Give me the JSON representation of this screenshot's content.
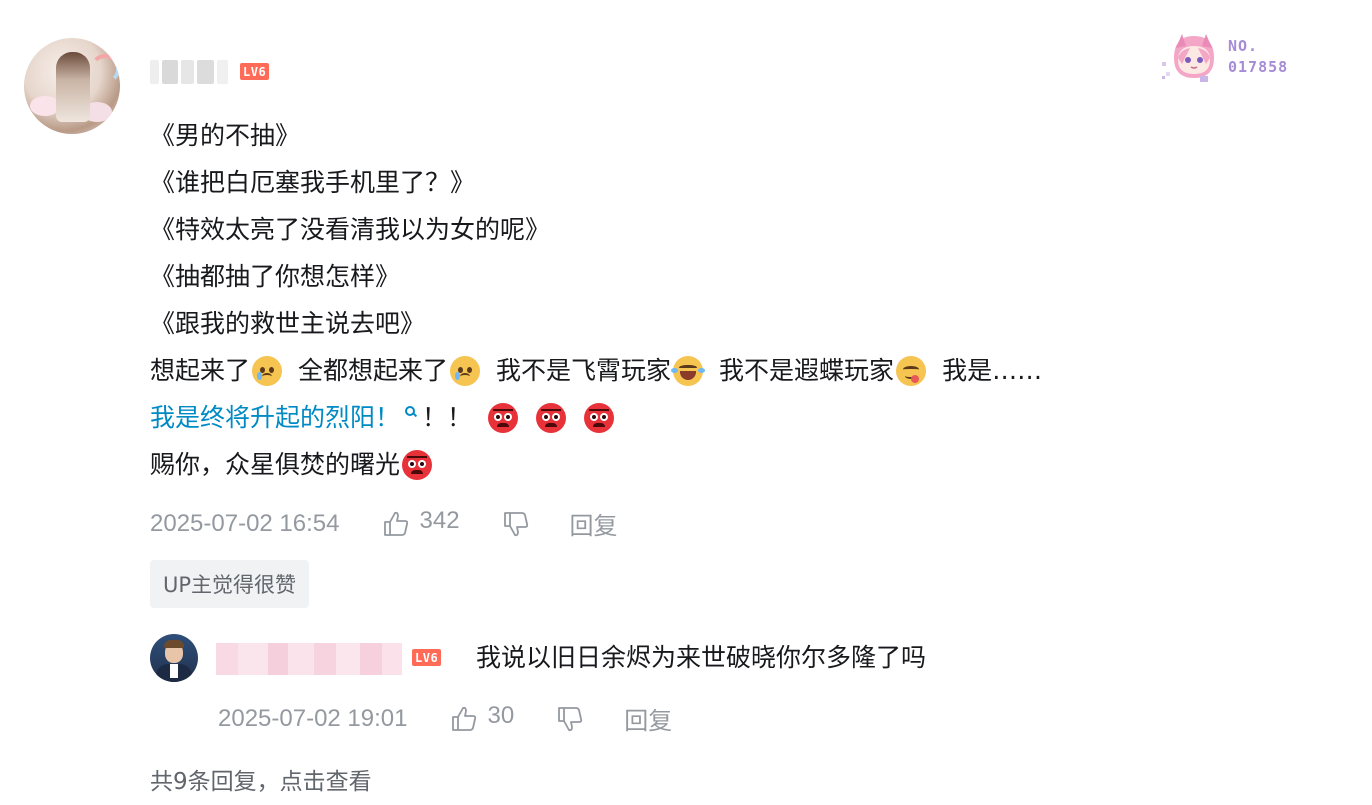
{
  "comment": {
    "level_badge": "LV6",
    "fan_badge": {
      "label_no": "NO.",
      "number": "017858"
    },
    "lines": [
      "《男的不抽》",
      "《谁把白厄塞我手机里了？》",
      "《特效太亮了没看清我以为女的呢》",
      "《抽都抽了你想怎样》",
      "《跟我的救世主说去吧》"
    ],
    "line6": {
      "p1": "想起来了",
      "p2": "全都想起来了",
      "p3": "我不是飞霄玩家",
      "p4": "我不是遐蝶玩家",
      "p5": "我是……"
    },
    "line7": {
      "link": "我是终将升起的烈阳！",
      "tail": "！！"
    },
    "line8": "赐你，众星俱焚的曙光",
    "time": "2025-07-02 16:54",
    "likes": "342",
    "reply_label": "回复",
    "up_liked_tag": "UP主觉得很赞"
  },
  "reply": {
    "level_badge": "LV6",
    "text": "我说以旧日余烬为来世破晓你尔多隆了吗",
    "time": "2025-07-02 19:01",
    "likes": "30",
    "reply_label": "回复"
  },
  "more_replies": {
    "prefix": "共9条回复，",
    "action": "点击查看"
  },
  "icons": {
    "like": "thumb-up-icon",
    "dislike": "thumb-down-icon",
    "search": "search-icon",
    "emoji_sad": "crying-face-emoji",
    "emoji_laugh": "laughing-face-emoji",
    "emoji_tongue": "tongue-face-emoji",
    "emoji_angry": "angry-face-emoji"
  },
  "colors": {
    "link": "#008ac5",
    "level_badge": "#ff6b57",
    "fan_badge_text": "#a68bd6",
    "muted": "#9499a0"
  }
}
